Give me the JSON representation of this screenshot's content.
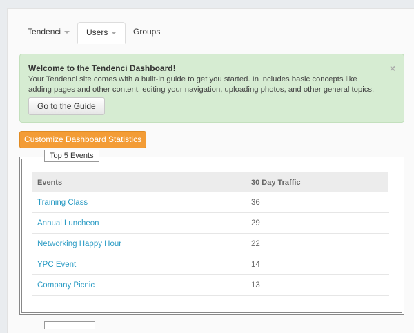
{
  "tabs": [
    {
      "label": "Tendenci",
      "has_caret": true
    },
    {
      "label": "Users",
      "has_caret": true
    },
    {
      "label": "Groups",
      "has_caret": false
    }
  ],
  "alert": {
    "title": "Welcome to the Tendenci Dashboard!",
    "body": "Your Tendenci site comes with a built-in guide to get you started. In includes basic concepts like adding pages and other content, editing your navigation, uploading photos, and other general topics.",
    "close": "×",
    "button": "Go to the Guide"
  },
  "customize_button": "Customize Dashboard Statistics",
  "events_box": {
    "label": "Top 5 Events",
    "columns": [
      "Events",
      "30 Day Traffic"
    ],
    "rows": [
      {
        "name": "Training Class",
        "traffic": "36"
      },
      {
        "name": "Annual Luncheon",
        "traffic": "29"
      },
      {
        "name": "Networking Happy Hour",
        "traffic": "22"
      },
      {
        "name": "YPC Event",
        "traffic": "14"
      },
      {
        "name": "Company Picnic",
        "traffic": "13"
      }
    ]
  },
  "colors": {
    "alert_bg": "#d6ecd2",
    "accent_orange": "#f39c36",
    "link": "#2a9bc4"
  }
}
